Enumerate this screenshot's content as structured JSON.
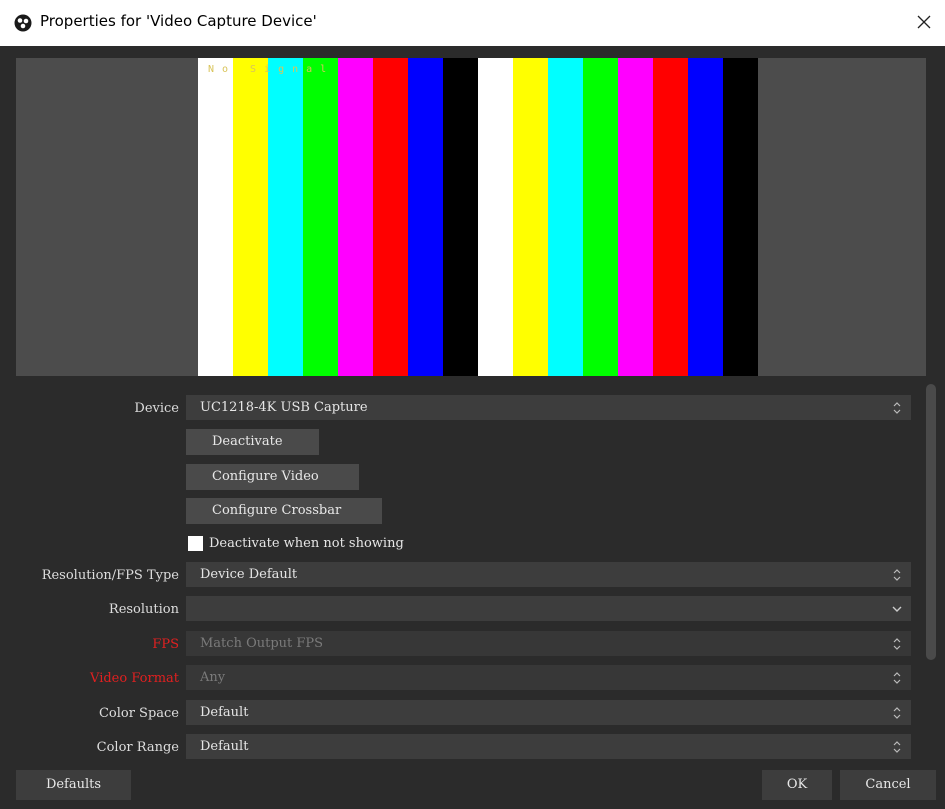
{
  "window": {
    "title": "Properties for 'Video Capture Device'",
    "app_icon": "obs-logo-icon",
    "close_glyph": "✕"
  },
  "preview": {
    "no_signal_text": "No Signal",
    "bar_colors": [
      "#ffffff",
      "#ffff00",
      "#00ffff",
      "#00ff00",
      "#ff00ff",
      "#ff0000",
      "#0000ff",
      "#000000"
    ]
  },
  "form": {
    "device": {
      "label": "Device",
      "value": "UC1218-4K USB Capture"
    },
    "buttons": {
      "deactivate": "Deactivate",
      "configure_video": "Configure Video",
      "configure_crossbar": "Configure Crossbar"
    },
    "deactivate_when_not_showing": {
      "label": "Deactivate when not showing",
      "checked": false
    },
    "resolution_fps_type": {
      "label": "Resolution/FPS Type",
      "value": "Device Default"
    },
    "resolution": {
      "label": "Resolution",
      "value": ""
    },
    "fps": {
      "label": "FPS",
      "value": "Match Output FPS"
    },
    "video_format": {
      "label": "Video Format",
      "value": "Any"
    },
    "color_space": {
      "label": "Color Space",
      "value": "Default"
    },
    "color_range": {
      "label": "Color Range",
      "value": "Default"
    }
  },
  "footer": {
    "defaults_label": "Defaults",
    "ok_label": "OK",
    "cancel_label": "Cancel"
  },
  "colors": {
    "background": "#2b2b2b",
    "field": "#3d3d3d",
    "text": "#dedede",
    "warning_label": "#e02020"
  }
}
